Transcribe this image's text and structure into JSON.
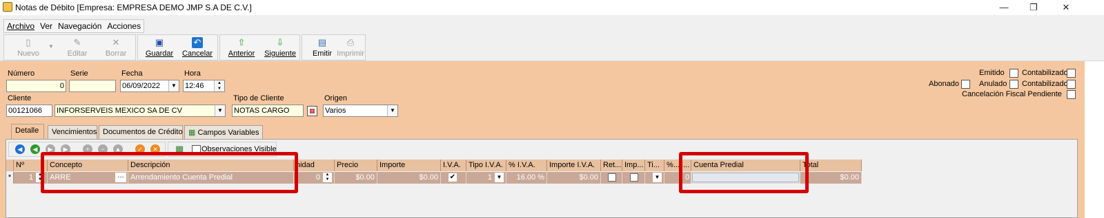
{
  "window": {
    "title": "Notas de Débito [Empresa: EMPRESA DEMO JMP S.A DE C.V.]"
  },
  "menu": [
    "Archivo",
    "Ver",
    "Navegación",
    "Acciones"
  ],
  "toolbar": {
    "nuevo": "Nuevo",
    "editar": "Editar",
    "borrar": "Borrar",
    "guardar": "Guardar",
    "cancelar": "Cancelar",
    "anterior": "Anterior",
    "siguiente": "Siguiente",
    "emitir": "Emitir",
    "imprimir": "Imprimir"
  },
  "header": {
    "numero_label": "Número",
    "numero_value": "0",
    "serie_label": "Serie",
    "serie_value": "",
    "fecha_label": "Fecha",
    "fecha_value": "06/09/2022",
    "hora_label": "Hora",
    "hora_value": "12:46",
    "cliente_label": "Cliente",
    "cliente_code": "00121066",
    "cliente_name": "INFORSERVEIS MEXICO SA DE CV",
    "tipo_cliente_label": "Tipo de Cliente",
    "tipo_cliente_value": "NOTAS CARGO",
    "origen_label": "Origen",
    "origen_value": "Varios"
  },
  "status": {
    "emitido": "Emitido",
    "contabilizado": "Contabilizado",
    "abonado": "Abonado",
    "anulado": "Anulado",
    "cancelacion": "Cancelación Fiscal Pendiente"
  },
  "tabs": [
    "Detalle",
    "Vencimientos",
    "Documentos de Crédito",
    "Campos Variables"
  ],
  "grid_toolbar": {
    "observaciones": "Observaciones Visible"
  },
  "grid": {
    "columns": [
      "Nº",
      "Concepto",
      "Descripción",
      "Unidad",
      "Precio",
      "Importe",
      "I.V.A.",
      "Tipo I.V.A.",
      "% I.V.A.",
      "Importe I.V.A.",
      "Ret...",
      "Imp...",
      "Ti...",
      "%...",
      "...",
      "Cuenta Predial",
      "Total"
    ],
    "header_visible": {
      "unidad": "nidad",
      "total": "Total"
    },
    "row": {
      "marker": "*",
      "num": "1",
      "concepto": "ARRE",
      "descripcion": "Arrendamiento Cuenta Predial",
      "unidad": "0",
      "precio": "$0.00",
      "importe": "$0.00",
      "tipo_iva": "1",
      "pct_iva": "16.00 %",
      "importe_iva": "$0.00",
      "dots_value": "0",
      "cuenta_predial": "",
      "total": "$0.00"
    }
  },
  "colors": {
    "form_bg": "#f5c7a0",
    "header_bg": "#e8c1a0",
    "row_bg": "#c9a898",
    "highlight": "#d40000"
  }
}
